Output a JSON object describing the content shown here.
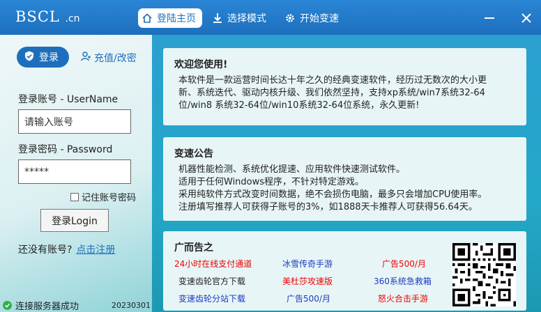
{
  "header": {
    "logo_main": "BSCL",
    "logo_sub": ".cn",
    "tabs": [
      {
        "label": "登陆主页",
        "icon": "home-icon",
        "active": true
      },
      {
        "label": "选择模式",
        "icon": "download-icon",
        "active": false
      },
      {
        "label": "开始变速",
        "icon": "gear-icon",
        "active": false
      }
    ]
  },
  "login": {
    "tab_label": "登录",
    "recharge_label": "充值/改密",
    "username_label": "登录账号 - UserName",
    "username_value": "请输入账号",
    "password_label": "登录密码 - Password",
    "password_value": "*****",
    "remember_label": "记住账号密码",
    "submit_label": "登录Login",
    "no_account_text": "还没有账号?",
    "register_link": "点击注册",
    "status_text": "连接服务器成功",
    "version": "20230301"
  },
  "welcome": {
    "title": "欢迎您使用!",
    "lines": [
      "本软件是一款运营时间长达十年之久的经典变速软件，经历过无数次的大小更",
      "新、系统迭代、驱动内核升级、我们依然坚持，支持xp系统/win7系统32-64",
      "位/win8 系统32-64位/win10系统32-64位系统，永久更新!"
    ]
  },
  "notice": {
    "title": "变速公告",
    "lines": [
      "机器性能检测、系统优化提速、应用软件快速测试软件。",
      "适用于任何Windows程序，不针对特定游戏。",
      "采用纯软件方式改变时间数据，绝不会损伤电脑，最多只会增加CPU使用率。",
      "注册填写推荐人可获得子账号的3%，如1888天卡推荐人可获得56.64天。"
    ]
  },
  "ads": {
    "title": "广而告之",
    "items": [
      {
        "text": "24小时在线支付通道",
        "color": "#e00000"
      },
      {
        "text": "冰雪传奇手游",
        "color": "#1a3bbf"
      },
      {
        "text": "广告500/月",
        "color": "#e00000"
      },
      {
        "text": "变速齿轮官方下载",
        "color": "#222222"
      },
      {
        "text": "美杜莎攻速版",
        "color": "#e00000"
      },
      {
        "text": "360系统急救箱",
        "color": "#1a3bbf"
      },
      {
        "text": "变速齿轮分站下载",
        "color": "#1a3bbf"
      },
      {
        "text": "广告500/月",
        "color": "#1a3bbf"
      },
      {
        "text": "怒火合击手游",
        "color": "#e00000"
      }
    ]
  },
  "colors": {
    "accent": "#1d6fbd",
    "status_ok": "#2fb14a"
  }
}
